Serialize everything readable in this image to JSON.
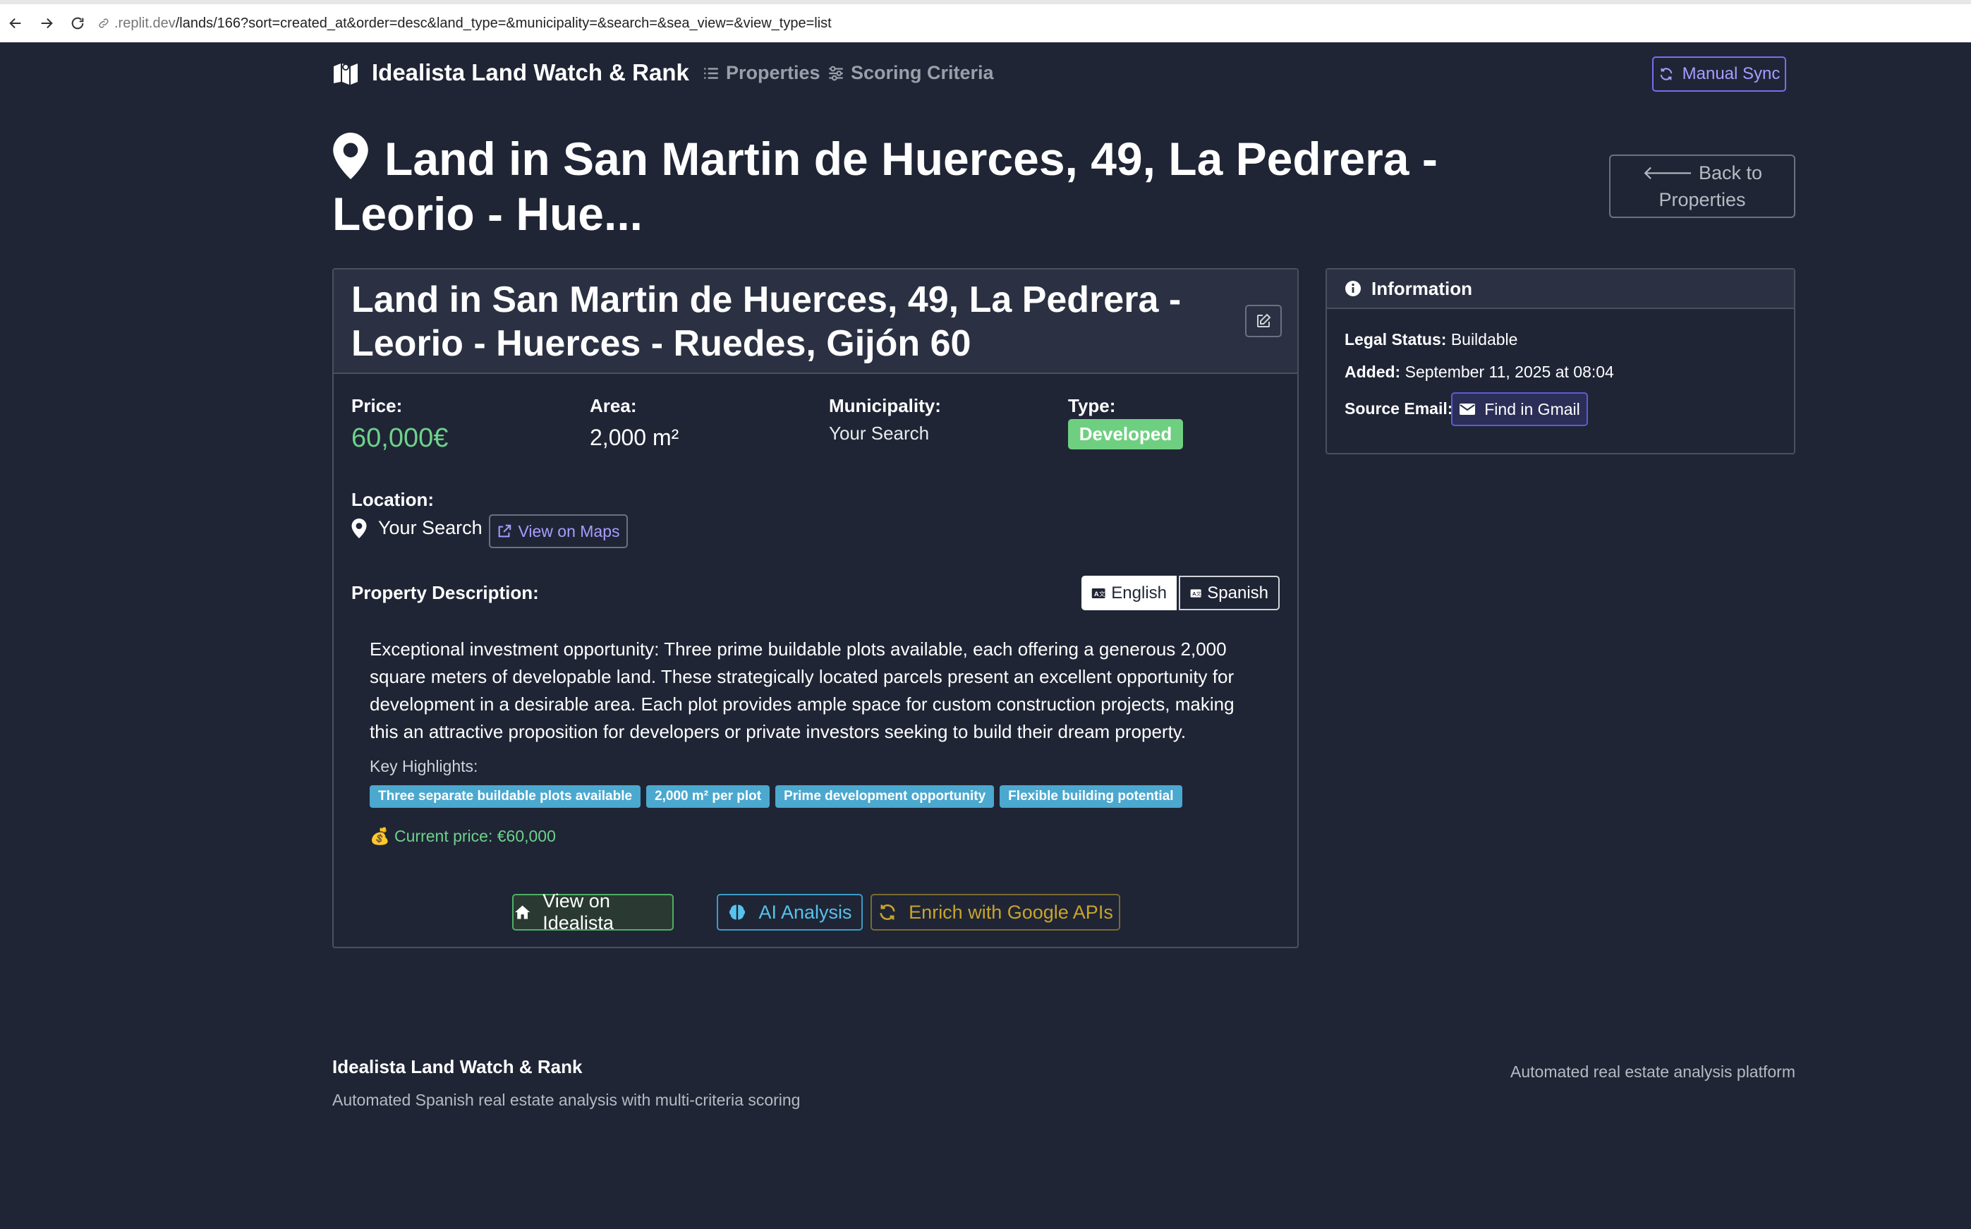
{
  "browser": {
    "url_host": ".replit.dev",
    "url_path": "/lands/166?sort=created_at&order=desc&land_type=&municipality=&search=&sea_view=&view_type=list"
  },
  "navbar": {
    "brand": "Idealista Land Watch & Rank",
    "links": [
      "Properties",
      "Scoring Criteria"
    ],
    "sync_label": "Manual Sync"
  },
  "page": {
    "title": "Land in San Martin de Huerces, 49, La Pedrera - Leorio - Hue...",
    "back_label_1": "Back to",
    "back_label_2": "Properties"
  },
  "property": {
    "title": "Land in San Martin de Huerces, 49, La Pedrera - Leorio - Huerces - Ruedes, Gijón 60",
    "price_label": "Price:",
    "price": "60,000€",
    "area_label": "Area:",
    "area": "2,000 m²",
    "municipality_label": "Municipality:",
    "municipality": "Your Search",
    "type_label": "Type:",
    "type": "Developed",
    "location_label": "Location:",
    "location": "Your Search",
    "maps_label": "View on Maps",
    "description_label": "Property Description:",
    "languages": [
      "English",
      "Spanish"
    ],
    "description": "Exceptional investment opportunity: Three prime buildable plots available, each offering a generous 2,000 square meters of developable land. These strategically located parcels present an excellent opportunity for development in a desirable area. Each plot provides ample space for custom construction projects, making this an attractive proposition for developers or private investors seeking to build their dream property.",
    "highlights_label": "Key Highlights:",
    "highlights": [
      "Three separate buildable plots available",
      "2,000 m² per plot",
      "Prime development opportunity",
      "Flexible building potential"
    ],
    "current_price": "💰 Current price: €60,000",
    "actions": {
      "idealista": "View on Idealista",
      "ai": "AI Analysis",
      "enrich": "Enrich with Google APIs"
    }
  },
  "info": {
    "header": "Information",
    "legal_label": "Legal Status:",
    "legal_value": "Buildable",
    "added_label": "Added:",
    "added_value": "September 11, 2025 at 08:04",
    "source_label": "Source Email:",
    "gmail_label": "Find in Gmail"
  },
  "footer": {
    "title": "Idealista Land Watch & Rank",
    "subtitle": "Automated Spanish real estate analysis with multi-criteria scoring",
    "right": "Automated real estate analysis platform"
  },
  "colors": {
    "background": "#1f2535",
    "price_green": "#6dd28a",
    "badge_green": "#6fcf81",
    "tag_blue": "#4ba8cf",
    "accent_purple": "#a99cff"
  }
}
